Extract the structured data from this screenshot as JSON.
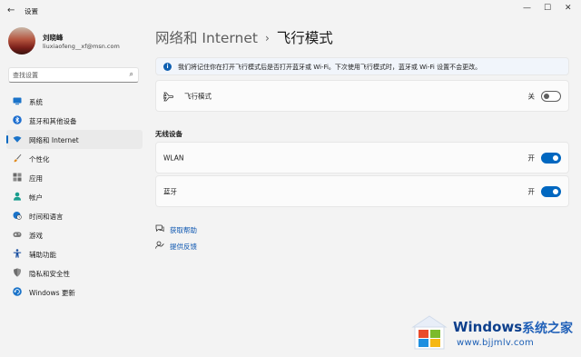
{
  "window": {
    "title": "设置",
    "back_icon": "back-arrow-icon",
    "controls": [
      "minimize-icon",
      "maximize-icon",
      "close-icon"
    ]
  },
  "profile": {
    "name": "刘晓峰",
    "email": "liuxiaofeng__xf@msn.com"
  },
  "search": {
    "placeholder": "查找设置"
  },
  "sidebar": {
    "items": [
      {
        "label": "系统",
        "icon": "system-icon",
        "active": false
      },
      {
        "label": "蓝牙和其他设备",
        "icon": "bluetooth-icon",
        "active": false
      },
      {
        "label": "网络和 Internet",
        "icon": "wifi-icon",
        "active": true
      },
      {
        "label": "个性化",
        "icon": "brush-icon",
        "active": false
      },
      {
        "label": "应用",
        "icon": "apps-icon",
        "active": false
      },
      {
        "label": "帐户",
        "icon": "account-icon",
        "active": false
      },
      {
        "label": "时间和语言",
        "icon": "globe-clock-icon",
        "active": false
      },
      {
        "label": "游戏",
        "icon": "gaming-icon",
        "active": false
      },
      {
        "label": "辅助功能",
        "icon": "accessibility-icon",
        "active": false
      },
      {
        "label": "隐私和安全性",
        "icon": "shield-icon",
        "active": false
      },
      {
        "label": "Windows 更新",
        "icon": "update-icon",
        "active": false
      }
    ]
  },
  "breadcrumb": {
    "parent": "网络和 Internet",
    "separator": "›",
    "current": "飞行模式"
  },
  "info_bar": {
    "text": "我们将记住你在打开飞行模式后是否打开蓝牙或 Wi-Fi。下次使用飞行模式时，蓝牙或 Wi-Fi 设置不会更改。"
  },
  "airplane": {
    "label": "飞行模式",
    "state": "关",
    "on": false
  },
  "wireless": {
    "title": "无线设备",
    "wlan": {
      "label": "WLAN",
      "state": "开",
      "on": true
    },
    "bluetooth": {
      "label": "蓝牙",
      "state": "开",
      "on": true
    }
  },
  "links": {
    "help": "获取帮助",
    "feedback": "提供反馈"
  },
  "watermark": {
    "brand": "Windows",
    "cn": "系统之家",
    "url": "www.bjjmlv.com"
  },
  "colors": {
    "accent": "#0067c0",
    "link": "#0b55b0",
    "background": "#f3f3f3",
    "card": "#fbfbfb"
  }
}
